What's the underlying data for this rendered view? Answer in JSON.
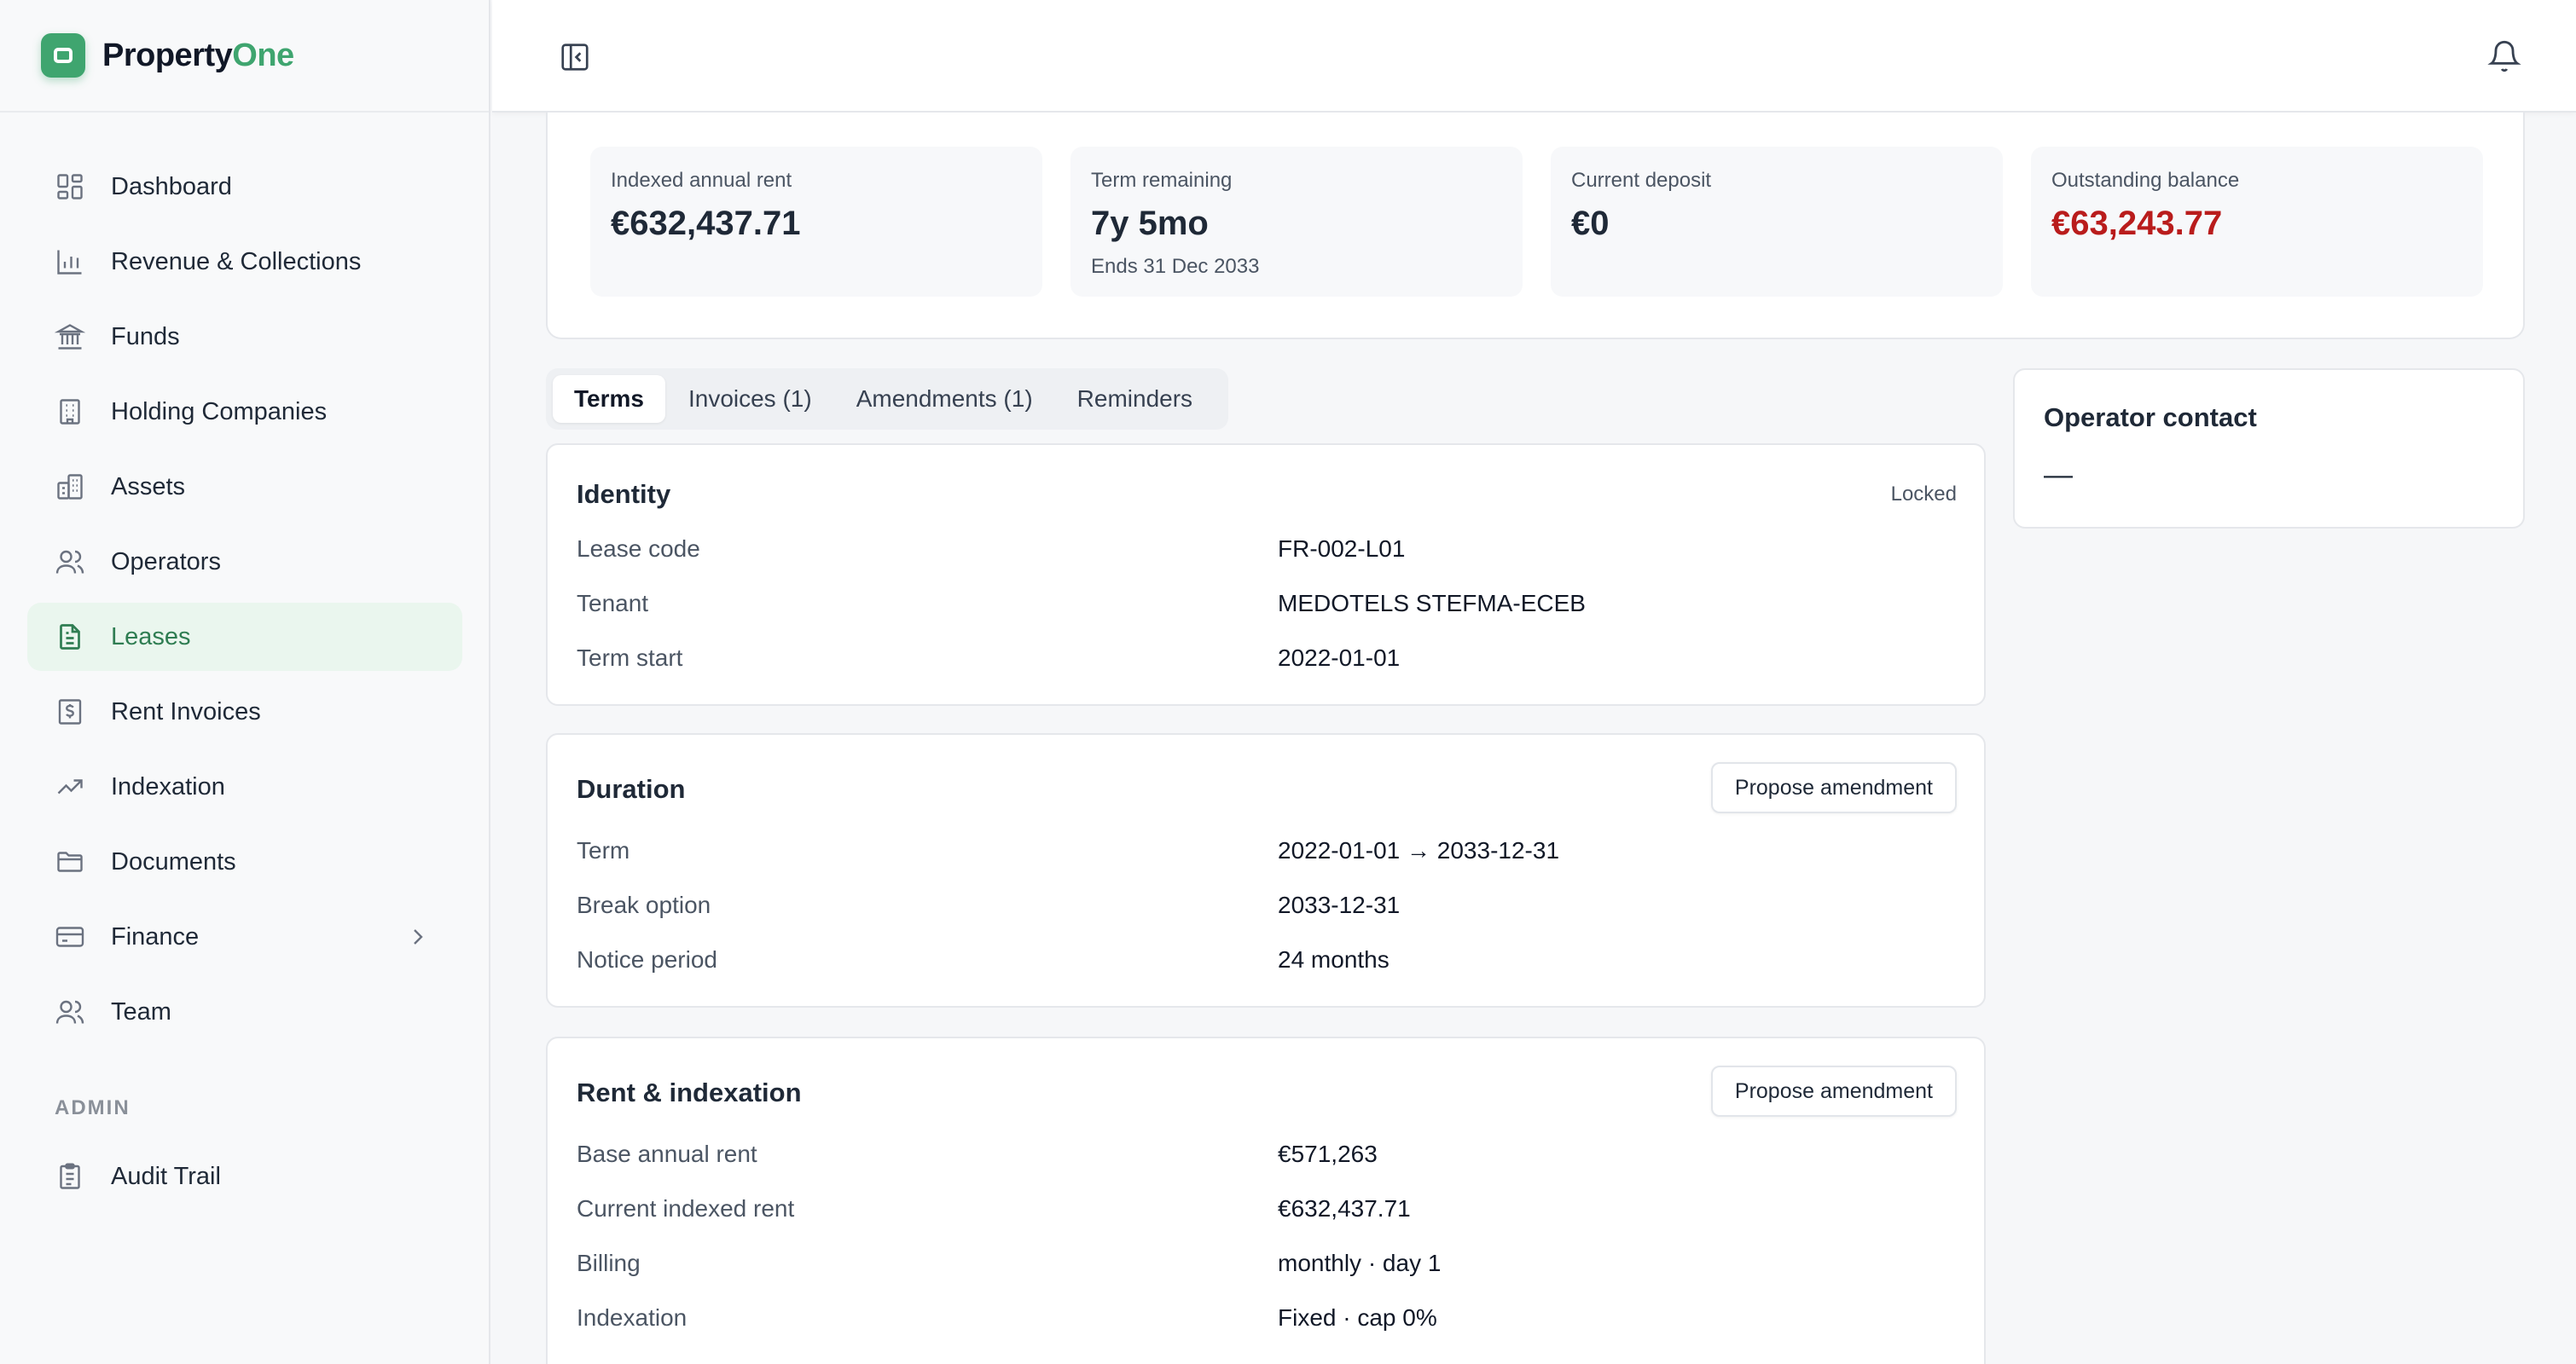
{
  "brand": {
    "name_prefix": "Property",
    "name_accent": "One",
    "accent_color": "#3fa56f"
  },
  "sidebar": {
    "items": [
      {
        "label": "Dashboard",
        "icon": "dashboard-icon"
      },
      {
        "label": "Revenue & Collections",
        "icon": "bar-chart-icon"
      },
      {
        "label": "Funds",
        "icon": "bank-icon"
      },
      {
        "label": "Holding Companies",
        "icon": "building-icon"
      },
      {
        "label": "Assets",
        "icon": "buildings-icon"
      },
      {
        "label": "Operators",
        "icon": "users-icon"
      },
      {
        "label": "Leases",
        "icon": "document-icon",
        "active": true
      },
      {
        "label": "Rent Invoices",
        "icon": "invoice-icon"
      },
      {
        "label": "Indexation",
        "icon": "trend-up-icon"
      },
      {
        "label": "Documents",
        "icon": "folder-icon"
      },
      {
        "label": "Finance",
        "icon": "credit-card-icon",
        "has_submenu": true
      },
      {
        "label": "Team",
        "icon": "users-icon"
      }
    ],
    "admin_label": "ADMIN",
    "admin_items": [
      {
        "label": "Audit Trail",
        "icon": "clipboard-icon"
      }
    ]
  },
  "stats": [
    {
      "label": "Indexed annual rent",
      "value": "€632,437.71"
    },
    {
      "label": "Term remaining",
      "value": "7y 5mo",
      "sub": "Ends 31 Dec 2033"
    },
    {
      "label": "Current deposit",
      "value": "€0"
    },
    {
      "label": "Outstanding balance",
      "value": "€63,243.77",
      "negative_color": "#b91c1c"
    }
  ],
  "tabs": [
    "Terms",
    "Invoices (1)",
    "Amendments (1)",
    "Reminders"
  ],
  "identity": {
    "title": "Identity",
    "tag": "Locked",
    "rows": [
      {
        "k": "Lease code",
        "v": "FR-002-L01"
      },
      {
        "k": "Tenant",
        "v": "MEDOTELS STEFMA-ECEB"
      },
      {
        "k": "Term start",
        "v": "2022-01-01"
      }
    ]
  },
  "duration": {
    "title": "Duration",
    "button": "Propose amendment",
    "rows": [
      {
        "k": "Term",
        "v": "2022-01-01 → 2033-12-31"
      },
      {
        "k": "Break option",
        "v": "2033-12-31"
      },
      {
        "k": "Notice period",
        "v": "24 months"
      }
    ]
  },
  "rent": {
    "title": "Rent & indexation",
    "button": "Propose amendment",
    "rows": [
      {
        "k": "Base annual rent",
        "v": "€571,263"
      },
      {
        "k": "Current indexed rent",
        "v": "€632,437.71"
      },
      {
        "k": "Billing",
        "v": "monthly · day 1"
      },
      {
        "k": "Indexation",
        "v": "Fixed · cap 0%"
      }
    ]
  },
  "contact": {
    "title": "Operator contact",
    "value": "—"
  }
}
